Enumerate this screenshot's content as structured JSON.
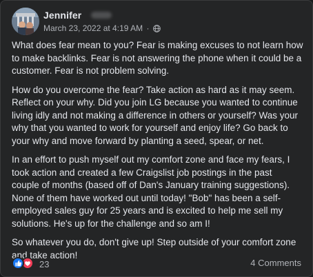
{
  "post": {
    "author": "Jennifer",
    "timestamp": "March 23, 2022 at 4:19 AM",
    "separator": "·",
    "audience_icon": "globe-icon",
    "paragraphs": [
      "What does fear mean to you? Fear is making excuses to not learn how\nto make backlinks. Fear is not answering the phone when it could be a\ncustomer. Fear is not problem solving.",
      "How do you overcome the fear? Take action as hard as it may seem.\nReflect on your why. Did you join LG because you wanted to continue\nliving idly and not making a difference in others or yourself? Was your\nwhy that you wanted to work for yourself and enjoy life? Go back to\nyour why and move forward by planting a seed, spear, or net.",
      "In an effort to push myself out my comfort zone and face my fears, I\ntook action and created a few Craigslist job postings in the past\ncouple of months (based off of Dan's January training suggestions).\nNone of them have worked out until today! \"Bob\" has been a self-\nemployed sales guy for 25 years and is excited to help me sell my\nsolutions. He's up for the challenge and so am I!",
      "So whatever you do, don't give up! Step outside of your comfort zone\nand take action!"
    ]
  },
  "footer": {
    "reaction_icons": [
      "like-icon",
      "love-icon"
    ],
    "reaction_count": "23",
    "comments_label": "4 Comments"
  },
  "colors": {
    "card_bg": "#242526",
    "text_primary": "#e4e6eb",
    "text_secondary": "#b0b3b8",
    "like_blue": "#1877f2",
    "love_red": "#f33e58"
  }
}
